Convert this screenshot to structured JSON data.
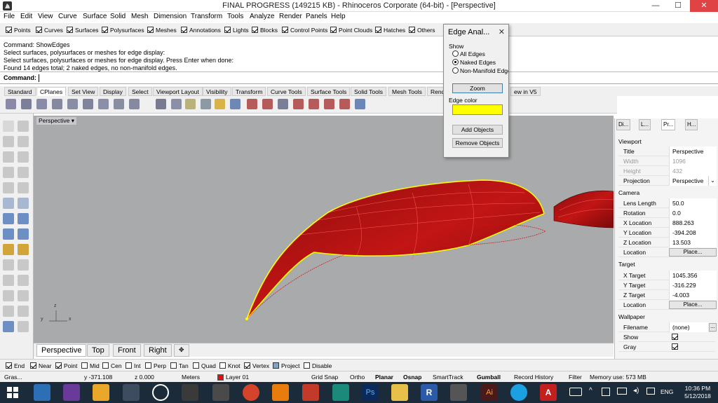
{
  "window": {
    "title": "FINAL PROGRESS (149215 KB) - Rhinoceros Corporate (64-bit) - [Perspective]",
    "minimize": "—",
    "maximize": "☐",
    "close": "✕"
  },
  "menu": [
    "File",
    "Edit",
    "View",
    "Curve",
    "Surface",
    "Solid",
    "Mesh",
    "Dimension",
    "Transform",
    "Tools",
    "Analyze",
    "Render",
    "Panels",
    "Help"
  ],
  "filters": [
    {
      "label": "Points",
      "checked": true
    },
    {
      "label": "Curves",
      "checked": true
    },
    {
      "label": "Surfaces",
      "checked": true
    },
    {
      "label": "Polysurfaces",
      "checked": true
    },
    {
      "label": "Meshes",
      "checked": true
    },
    {
      "label": "Annotations",
      "checked": true
    },
    {
      "label": "Lights",
      "checked": true
    },
    {
      "label": "Blocks",
      "checked": true
    },
    {
      "label": "Control Points",
      "checked": true
    },
    {
      "label": "Point Clouds",
      "checked": true
    },
    {
      "label": "Hatches",
      "checked": true
    },
    {
      "label": "Others",
      "checked": true
    }
  ],
  "command_history": [
    "Command: ShowEdges",
    "Select surfaces, polysurfaces or meshes for edge display:",
    "Select surfaces, polysurfaces or meshes for edge display. Press Enter when done:",
    "Found 14 edges total; 2 naked edges, no non-manifold edges."
  ],
  "command_prompt": "Command:",
  "toolbar_tabs": [
    "Standard",
    "CPlanes",
    "Set View",
    "Display",
    "Select",
    "Viewport Layout",
    "Visibility",
    "Transform",
    "Curve Tools",
    "Surface Tools",
    "Solid Tools",
    "Mesh Tools",
    "Rend",
    "ew in V5"
  ],
  "active_toolbar_tab": "CPlanes",
  "viewport": {
    "label": "Perspective",
    "label_arrow": "▾",
    "axis_z": "z",
    "axis_y": "y",
    "axis_x": "x"
  },
  "viewport_tabs": [
    "Perspective",
    "Top",
    "Front",
    "Right"
  ],
  "viewport_tab_add": "✥",
  "edge_dialog": {
    "title": "Edge Anal...",
    "close": "✕",
    "show_label": "Show",
    "options": [
      {
        "label": "All Edges",
        "selected": false
      },
      {
        "label": "Naked Edges",
        "selected": true
      },
      {
        "label": "Non-Manifold Edge",
        "selected": false
      }
    ],
    "zoom_button": "Zoom",
    "edge_color_label": "Edge color",
    "edge_color": "#ffff00",
    "add_objects": "Add Objects",
    "remove_objects": "Remove Objects"
  },
  "right_panel": {
    "tabs": [
      "Di...",
      "L...",
      "Pr...",
      "H..."
    ],
    "active_tab": "Pr...",
    "viewport_section": "Viewport",
    "title_label": "Title",
    "title_value": "Perspective",
    "width_label": "Width",
    "width_value": "1096",
    "height_label": "Height",
    "height_value": "432",
    "projection_label": "Projection",
    "projection_value": "Perspective",
    "camera_section": "Camera",
    "lens_label": "Lens Length",
    "lens_value": "50.0",
    "rotation_label": "Rotation",
    "rotation_value": "0.0",
    "xloc_label": "X Location",
    "xloc_value": "888.263",
    "yloc_label": "Y Location",
    "yloc_value": "-394.208",
    "zloc_label": "Z Location",
    "zloc_value": "13.503",
    "location_label": "Location",
    "location_button": "Place...",
    "target_section": "Target",
    "xt_label": "X Target",
    "xt_value": "1045.356",
    "yt_label": "Y Target",
    "yt_value": "-316.229",
    "zt_label": "Z Target",
    "zt_value": "-4.003",
    "tloc_label": "Location",
    "tloc_button": "Place...",
    "wallpaper_section": "Wallpaper",
    "filename_label": "Filename",
    "filename_value": "(none)",
    "filename_button": "...",
    "show_label": "Show",
    "show_checked": true,
    "gray_label": "Gray",
    "gray_checked": true
  },
  "osnaps": [
    {
      "label": "End",
      "checked": true
    },
    {
      "label": "Near",
      "checked": true
    },
    {
      "label": "Point",
      "checked": true
    },
    {
      "label": "Mid",
      "checked": false
    },
    {
      "label": "Cen",
      "checked": false
    },
    {
      "label": "Int",
      "checked": false
    },
    {
      "label": "Perp",
      "checked": false
    },
    {
      "label": "Tan",
      "checked": false
    },
    {
      "label": "Quad",
      "checked": false
    },
    {
      "label": "Knot",
      "checked": false
    },
    {
      "label": "Vertex",
      "checked": true
    },
    {
      "label": "Project",
      "checked": false
    },
    {
      "label": "Disable",
      "checked": false
    }
  ],
  "status": {
    "gras": "Gras...",
    "y": "y -371.108",
    "z": "z 0.000",
    "units": "Meters",
    "layer": "Layer 01",
    "layer_color": "#e01010",
    "grid_snap": "Grid Snap",
    "ortho": "Ortho",
    "planar": "Planar",
    "osnap": "Osnap",
    "smarttrack": "SmartTrack",
    "gumball": "Gumball",
    "record_history": "Record History",
    "filter": "Filter",
    "memory": "Memory use: 573 MB"
  },
  "taskbar": {
    "lang": "ENG",
    "time": "10:36 PM",
    "date": "5/12/2018"
  },
  "colors": {
    "viewport_bg": "#a9aaab",
    "surface_red": "#cc1111",
    "edge_yellow": "#ffff00",
    "taskbar": "#1c2b3a"
  }
}
